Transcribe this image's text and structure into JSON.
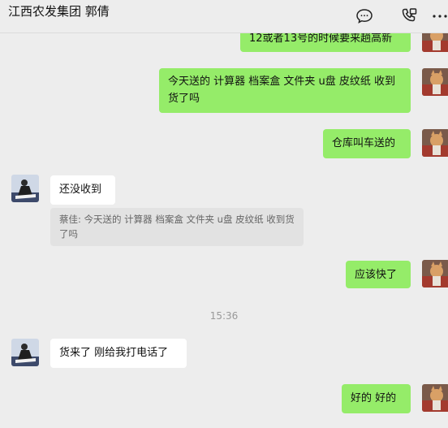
{
  "header": {
    "title": "江西农发集团 郭倩"
  },
  "messages": {
    "m1": "12或者13号的时候要来趟高新",
    "m2": "今天送的 计算器 档案盒 文件夹 u盘 皮纹纸 收到货了吗",
    "m3": "仓库叫车送的",
    "m4": "还没收到",
    "m4_quote": "蔡佳: 今天送的 计算器 档案盒 文件夹 u盘 皮纹纸 收到货了吗",
    "m5": "应该快了",
    "time1": "15:36",
    "m6": "货来了 刚给我打电话了",
    "m7": "好的 好的"
  },
  "icons": {
    "chat": "chat-bubble-icon",
    "call": "phone-call-icon",
    "more": "more-icon"
  },
  "colors": {
    "background": "#ededed",
    "my_bubble": "#95ec69",
    "their_bubble": "#ffffff",
    "quote_bg": "#e2e2e2"
  }
}
